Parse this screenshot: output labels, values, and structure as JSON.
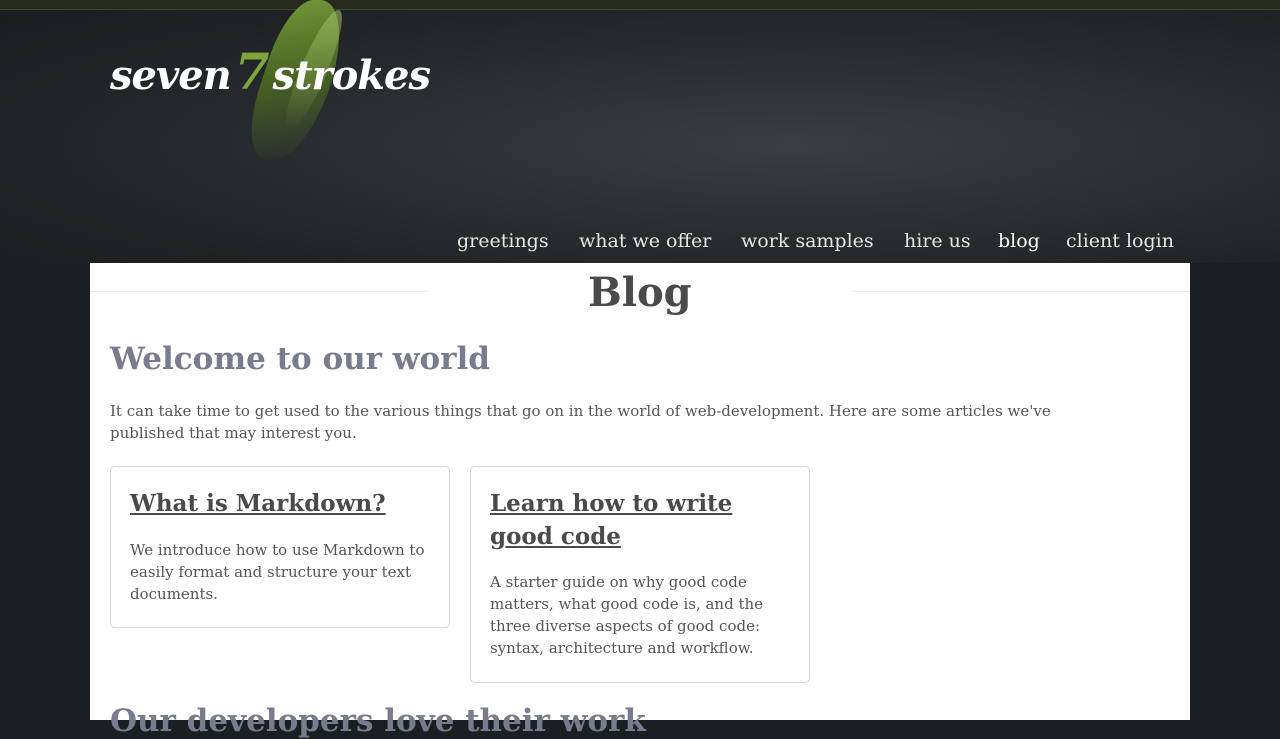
{
  "site": {
    "logo_word1": "seven",
    "logo_num": "7",
    "logo_word2": "strokes"
  },
  "nav": {
    "items": [
      {
        "label": "greetings"
      },
      {
        "label": "what we offer"
      },
      {
        "label": "work samples"
      },
      {
        "label": "hire us"
      },
      {
        "label": "blog"
      },
      {
        "label": "client login"
      }
    ]
  },
  "main": {
    "title": "Blog",
    "section_heading": "Welcome to our world",
    "intro": "It can take time to get used to the various things that go on in the world of web-development. Here are some articles we've published that may interest you.",
    "articles": [
      {
        "title": "What is Markdown?",
        "summary": "We introduce how to use Markdown to easily format and structure your text documents."
      },
      {
        "title": "Learn how to write good code",
        "summary": "A starter guide on why good code matters, what good code is, and the three diverse aspects of good code: syntax, architecture and workflow."
      }
    ],
    "next_heading": "Our developers love their work"
  },
  "colors": {
    "accent_green": "#7ea63a",
    "heading_gray_blue": "#777c8e",
    "header_dark": "#1c1f21"
  }
}
